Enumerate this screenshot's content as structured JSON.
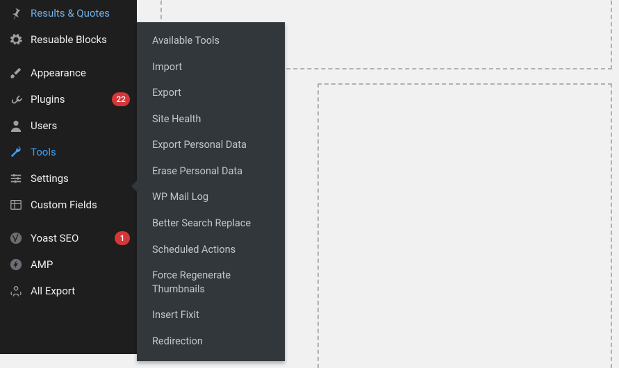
{
  "sidebar": {
    "items": [
      {
        "label": "Results & Quotes",
        "icon": "pin-icon"
      },
      {
        "label": "Resuable Blocks",
        "icon": "gear-icon"
      },
      {
        "label": "Appearance",
        "icon": "brush-icon"
      },
      {
        "label": "Plugins",
        "icon": "plug-icon",
        "badge": "22"
      },
      {
        "label": "Users",
        "icon": "user-icon"
      },
      {
        "label": "Tools",
        "icon": "wrench-icon",
        "active": true
      },
      {
        "label": "Settings",
        "icon": "sliders-icon"
      },
      {
        "label": "Custom Fields",
        "icon": "grid-icon"
      },
      {
        "label": "Yoast SEO",
        "icon": "yoast-icon",
        "badge": "1"
      },
      {
        "label": "AMP",
        "icon": "amp-icon"
      },
      {
        "label": "All Export",
        "icon": "export-icon"
      }
    ]
  },
  "submenu": {
    "items": [
      "Available Tools",
      "Import",
      "Export",
      "Site Health",
      "Export Personal Data",
      "Erase Personal Data",
      "WP Mail Log",
      "Better Search Replace",
      "Scheduled Actions",
      "Force Regenerate Thumbnails",
      "Insert Fixit",
      "Redirection"
    ]
  }
}
